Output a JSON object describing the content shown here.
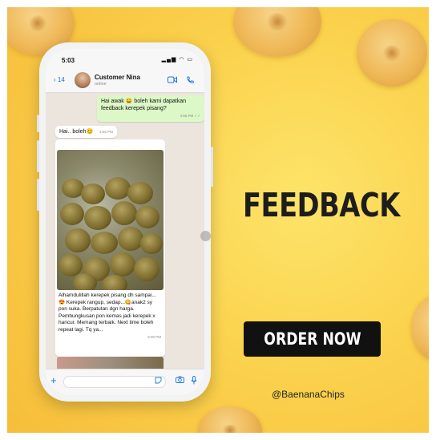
{
  "colors": {
    "background": "#fbd24d",
    "ios_blue": "#1a73e8",
    "outgoing_bubble": "#dcf8c6",
    "button_bg": "#111111"
  },
  "status_bar": {
    "time": "5:03"
  },
  "chat_header": {
    "back_count": "14",
    "contact_name": "Customer Nina",
    "contact_status": "online"
  },
  "messages": [
    {
      "direction": "outgoing",
      "text": "Hai awak 😀 boleh kami dapatkan feedback kerepek pisang?",
      "time": "4:55 PM ✓✓"
    },
    {
      "direction": "incoming",
      "text": "Hai.. boleh😊",
      "time": "4:56 PM"
    },
    {
      "direction": "incoming",
      "type": "photo",
      "caption": "Alhamdulillah kerepek pisang dh sampai...😍 Kerepek rangup, sedap...😋anak2 sy pon suka. Berpatutan dgn harga. Pembungkusan pon kemas jadi kerepek x hancur. Memang terbaik. Next time boleh repeat lagi. Tq ya...",
      "time": "5:00 PM"
    }
  ],
  "icons": [
    "back-chevron-icon",
    "video-call-icon",
    "phone-call-icon",
    "plus-icon",
    "sticker-icon",
    "camera-icon",
    "microphone-icon"
  ],
  "headline": "FEEDBACK",
  "cta": {
    "label": "ORDER NOW"
  },
  "handle": "@BaenanaChips"
}
